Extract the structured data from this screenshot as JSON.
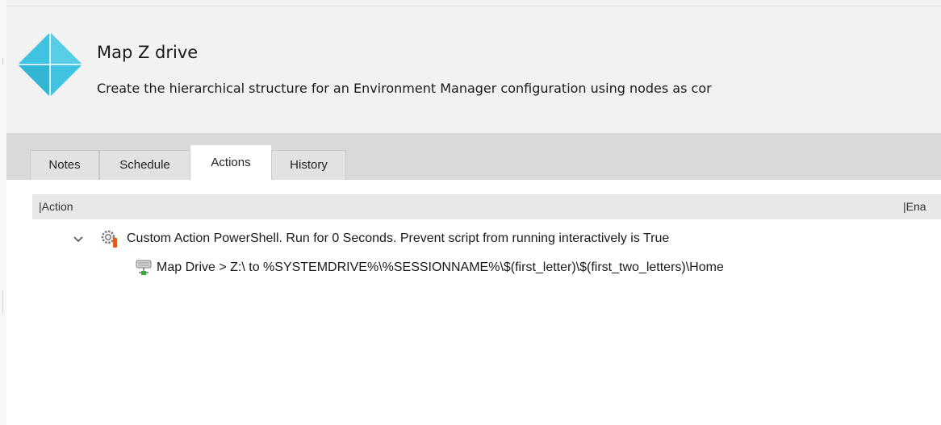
{
  "header": {
    "title": "Map Z drive",
    "description": "Create the hierarchical structure for an Environment Manager configuration using nodes as cor"
  },
  "tabs": [
    {
      "label": "Notes",
      "active": false
    },
    {
      "label": "Schedule",
      "active": false
    },
    {
      "label": "Actions",
      "active": true
    },
    {
      "label": "History",
      "active": false
    }
  ],
  "columns": {
    "action": "|Action",
    "enabled": "|Ena"
  },
  "actions": [
    {
      "icon": "gear-warning-icon",
      "expanded": true,
      "label": "Custom Action PowerShell. Run for 0 Seconds. Prevent script from running interactively is True"
    },
    {
      "icon": "network-drive-icon",
      "label": "Map Drive >  Z:\\ to %SYSTEMDRIVE%\\%SESSIONNAME%\\$(first_letter)\\$(first_two_letters)\\Home"
    }
  ],
  "colors": {
    "logo": "#3fc3e0",
    "tabbar": "#d9d9d9",
    "header_bg": "#f2f2f2"
  }
}
